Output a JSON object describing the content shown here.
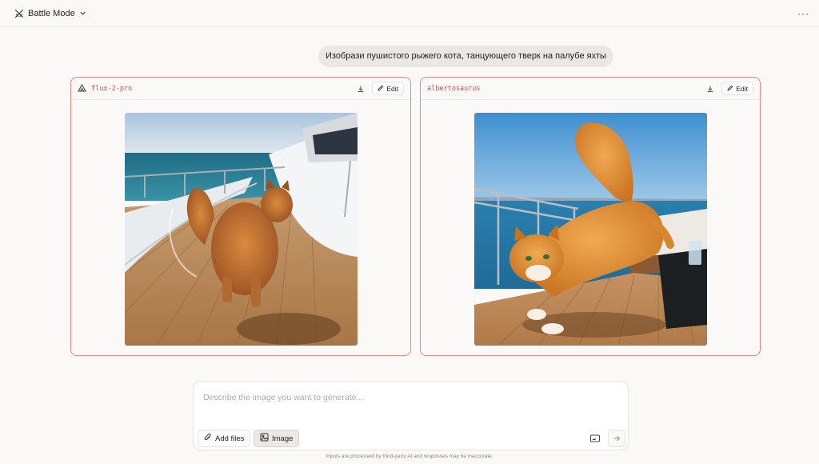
{
  "header": {
    "mode_label": "Battle Mode",
    "mode_icon": "swords-icon",
    "menu_icon": "more-horizontal-icon",
    "menu_label": "···"
  },
  "conversation": {
    "prompt": "Изобрази пушистого рыжего кота, танцующего тверк на палубе яхты"
  },
  "panels": [
    {
      "model": "flux-2-pro",
      "model_icon": "model-triangle-icon",
      "download_icon": "download-icon",
      "edit_label": "Edit",
      "image_alt": "Fluffy ginger cat on a yacht deck, facing away"
    },
    {
      "model": "albertosaurus",
      "download_icon": "download-icon",
      "edit_label": "Edit",
      "image_alt": "Fluffy ginger cat stretching on a yacht deck"
    }
  ],
  "composer": {
    "placeholder": "Describe the image you want to generate...",
    "add_files_label": "Add files",
    "image_label": "Image",
    "aspect_icon": "aspect-ratio-icon",
    "send_icon": "arrow-right-icon"
  },
  "footer": {
    "disclaimer": "Inputs are processed by third-party AI and responses may be inaccurate."
  },
  "colors": {
    "background": "#faf9f7",
    "panel_border": "#e08a84",
    "model_name": "#c9584d",
    "bubble": "#ebe8e3"
  }
}
